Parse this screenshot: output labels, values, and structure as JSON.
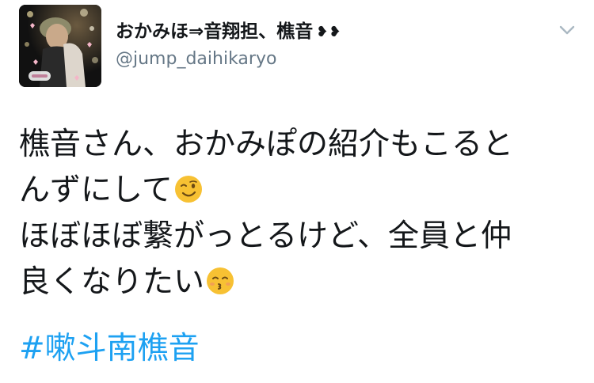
{
  "tweet": {
    "display_name": "おかみほ⇒音翔担、樵音",
    "name_decoration": "❥❥",
    "screen_name": "@jump_daihikaryo",
    "caret_icon": "chevron-down-icon",
    "text_lines": [
      "樵音さん、おかみぽの紹介もこると",
      "んずにして",
      "ほぼほぼ繋がっとるけど、全員と仲",
      "良くなりたい"
    ],
    "emoji_1": "winking-face-emoji",
    "emoji_2": "kissing-face-emoji",
    "hashtag": "#嗽斗南樵音"
  },
  "colors": {
    "text": "#14171a",
    "secondary": "#657786",
    "link": "#1da1f2",
    "emoji": "#f7c133"
  }
}
